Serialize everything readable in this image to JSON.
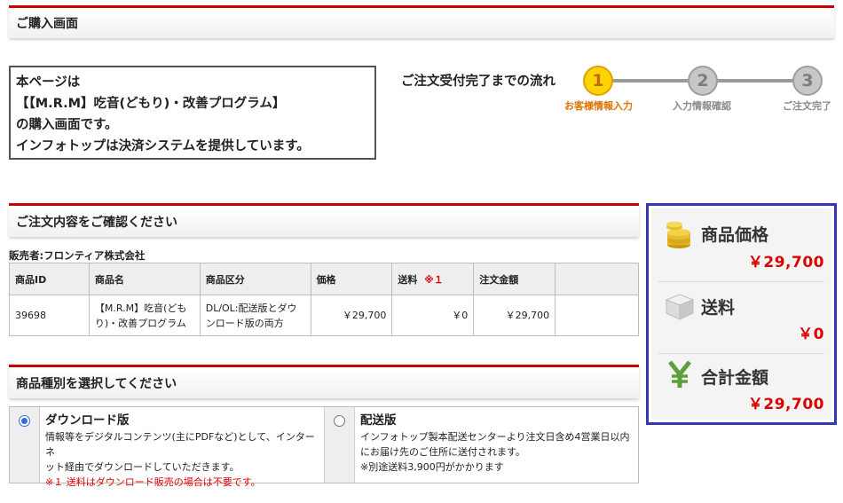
{
  "page_header": {
    "title": "ご購入画面"
  },
  "intro": {
    "line1": "本ページは",
    "line2": "【【M.R.M】吃音(どもり)・改善プログラム】",
    "line3": "の購入画面です。",
    "line4": "インフォトップは決済システムを提供しています。"
  },
  "flow": {
    "title": "ご注文受付完了までの流れ",
    "steps": [
      {
        "number": "1",
        "label": "お客様情報入力",
        "state": "active"
      },
      {
        "number": "2",
        "label": "入力情報確認",
        "state": "inactive"
      },
      {
        "number": "3",
        "label": "ご注文完了",
        "state": "inactive"
      }
    ]
  },
  "order_section": {
    "title": "ご注文内容をご確認ください",
    "seller": "販売者:フロンティア株式会社",
    "columns": {
      "id": "商品ID",
      "name": "商品名",
      "category": "商品区分",
      "price": "価格",
      "shipping": "送料",
      "shipping_note": "※１",
      "total": "注文金額"
    },
    "row": {
      "id": "39698",
      "name_line1": "【M.R.M】吃音(ども",
      "name_line2": "り)・改善プログラム",
      "category_line1": "DL/OL:配送版とダウ",
      "category_line2": "ンロード版の両方",
      "price": "￥29,700",
      "shipping": "￥0",
      "total": "￥29,700"
    }
  },
  "type_section": {
    "title": "商品種別を選択してください",
    "download": {
      "title": "ダウンロード版",
      "selected": true,
      "desc1": "情報等をデジタルコンテンツ(主にPDFなど)として、インターネ",
      "desc2": "ット経由でダウンロードしていただきます。",
      "note": "※１ 送料はダウンロード販売の場合は不要です。"
    },
    "shipping": {
      "title": "配送版",
      "selected": false,
      "desc1": "インフォトップ製本配送センターより注文日含め4営業日以内",
      "desc2": "にお届け先のご住所に送付されます。",
      "note": "※別途送料3,900円がかかります"
    }
  },
  "summary": {
    "product_price_label": "商品価格",
    "product_price": "￥29,700",
    "shipping_label": "送料",
    "shipping": "￥0",
    "total_label": "合計金額",
    "total": "￥29,700"
  },
  "colors": {
    "accent_red": "#cc0000",
    "price_red": "#dd0000",
    "summary_border": "#3436b5",
    "step_active": "#ffd400"
  },
  "icons": [
    "coins-icon",
    "box-icon",
    "yen-icon"
  ]
}
